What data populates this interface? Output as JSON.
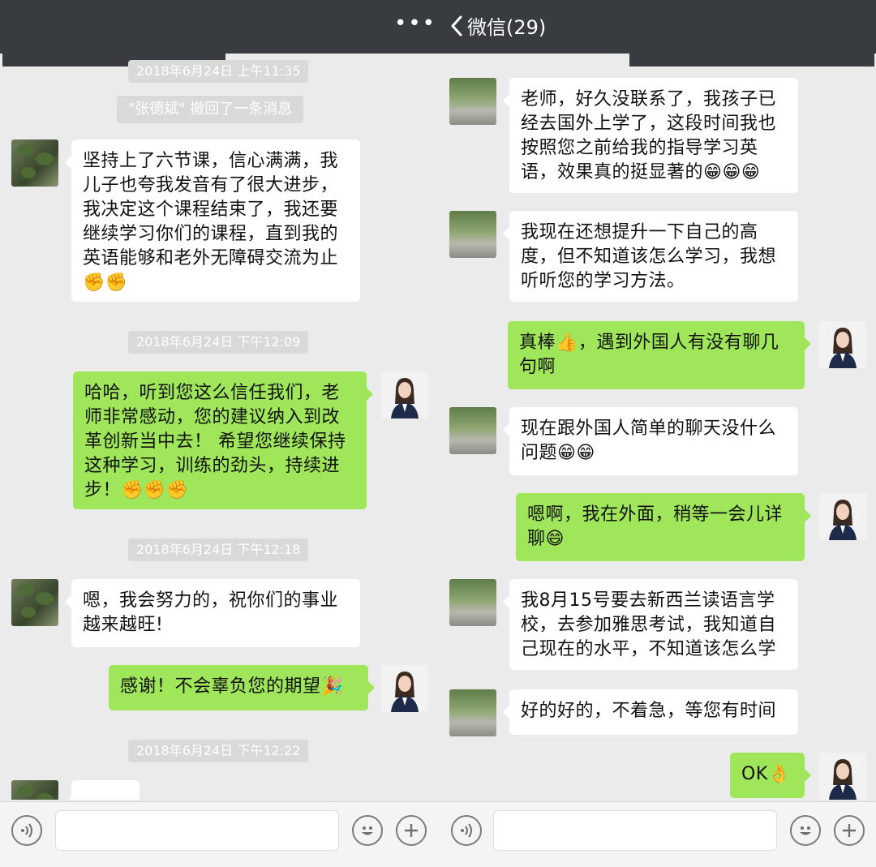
{
  "header": {
    "dots": "•••",
    "back_label": "微信(29)"
  },
  "left": {
    "stamps": [
      "2018年6月24日 上午11:35",
      "2018年6月24日 下午12:09",
      "2018年6月24日 下午12:18",
      "2018年6月24日 下午12:22"
    ],
    "notice": "\"张德斌\" 撤回了一条消息",
    "messages": [
      "坚持上了六节课，信心满满，我\n儿子也夸我发音有了很大进步，\n我决定这个课程结束了，我还要\n继续学习你们的课程，直到我的\n英语能够和老外无障碍交流为止\n✊✊",
      "哈哈，听到您这么信任我们，老\n师非常感动，您的建议纳入到改\n革创新当中去！ 希望您继续保持\n这种学习，训练的劲头，持续进\n步！✊✊✊",
      "嗯，我会努力的，祝你们的事业\n越来越旺!",
      "感谢！不会辜负您的期望🎉"
    ]
  },
  "right": {
    "messages": [
      "老师，好久没联系了，我孩子已\n经去国外上学了，这段时间我也\n按照您之前给我的指导学习英\n语，效果真的挺显著的😁😁😁",
      "我现在还想提升一下自己的高\n度，但不知道该怎么学习，我想\n听听您的学习方法。",
      "真棒👍，遇到外国人有没有聊几\n句啊",
      "现在跟外国人简单的聊天没什么\n问题😁😁",
      "嗯啊，我在外面，稍等一会儿详\n聊😄",
      "我8月15号要去新西兰读语言学\n校，去参加雅思考试，我知道自\n己现在的水平，不知道该怎么学",
      "好的好的，不着急，等您有时间",
      "OK👌"
    ]
  },
  "icons": [
    "voice-icon",
    "emoji-icon",
    "plus-icon",
    "back-chevron-icon",
    "more-dots-icon"
  ],
  "colors": {
    "header": "#383b40",
    "green_bubble": "#9fe65b",
    "background": "#ebebeb"
  }
}
